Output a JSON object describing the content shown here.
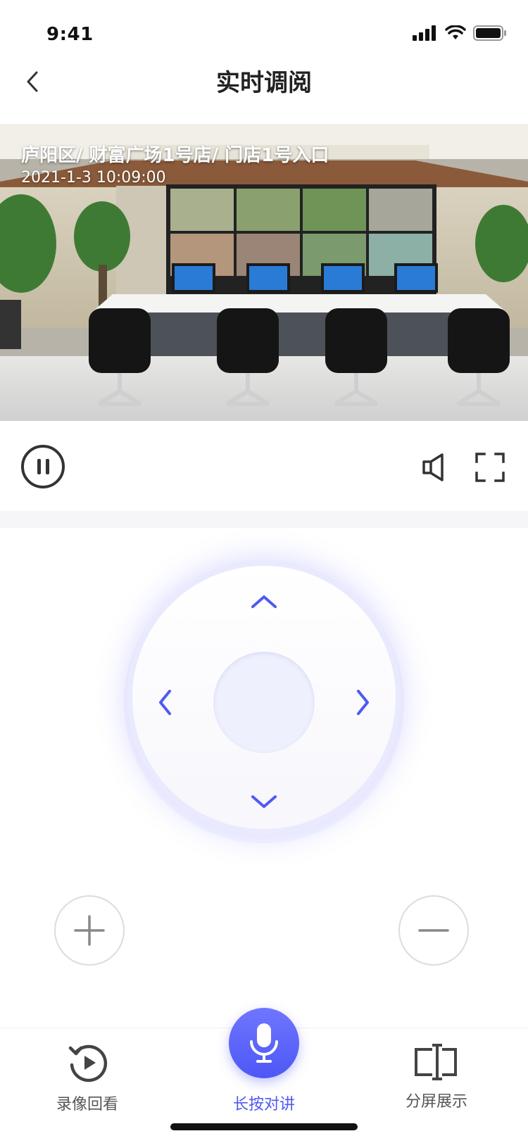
{
  "status_bar": {
    "time": "9:41"
  },
  "nav": {
    "title": "实时调阅",
    "back_icon": "chevron-left-icon"
  },
  "video": {
    "location": "庐阳区/ 财富广场1号店/ 门店1号入口",
    "timestamp": "2021-1-3 10:09:00"
  },
  "controls": {
    "pause_icon": "pause-icon",
    "volume_icon": "speaker-icon",
    "fullscreen_icon": "fullscreen-icon"
  },
  "ptz": {
    "accent": "#4f59f3"
  },
  "zoom": {
    "in_icon": "plus-icon",
    "out_icon": "minus-icon"
  },
  "tabs": [
    {
      "label": "录像回看",
      "icon": "replay-icon"
    },
    {
      "label": "长按对讲",
      "icon": "microphone-icon"
    },
    {
      "label": "分屏展示",
      "icon": "split-screen-icon"
    }
  ],
  "colors": {
    "accent": "#4f59f3",
    "text": "#222222",
    "muted": "#555555"
  }
}
